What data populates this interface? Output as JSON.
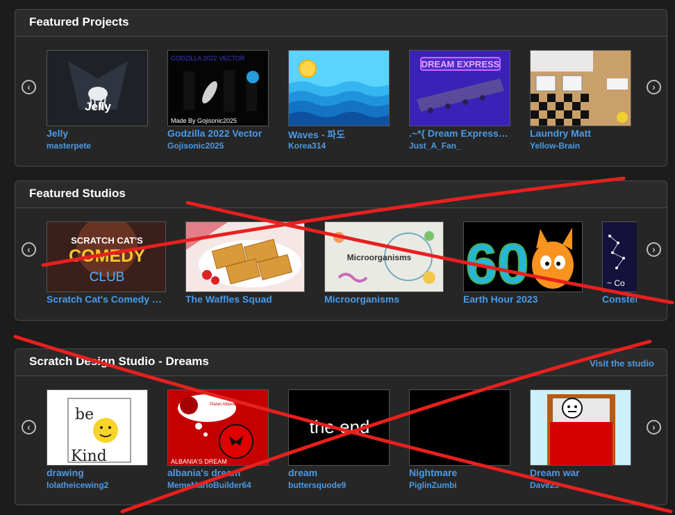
{
  "featured_projects": {
    "title": "Featured Projects",
    "items": [
      {
        "title": "Jelly",
        "author": "masterpete",
        "thumb_text": "Jelly"
      },
      {
        "title": "Godzilla 2022 Vector",
        "author": "Gojisonic2025",
        "thumb_text_top": "GODZILLA 2022 VECTOR",
        "thumb_text_bottom": "Made By Gojisonic2025"
      },
      {
        "title": "Waves - 파도",
        "author": "Korea314"
      },
      {
        "title": ".~*{ Dream Express }*~.",
        "author": "Just_A_Fan_",
        "thumb_text": "DREAM EXPRESS"
      },
      {
        "title": "Laundry Matt",
        "author": "Yellow-Brain"
      }
    ]
  },
  "featured_studios": {
    "title": "Featured Studios",
    "items": [
      {
        "title": "Scratch Cat's Comedy Club",
        "thumb_text_top": "SCRATCH CAT'S",
        "thumb_text_mid": "COMEDY",
        "thumb_text_bottom": "CLUB"
      },
      {
        "title": "The Waffles Squad"
      },
      {
        "title": "Microorganisms",
        "thumb_text": "Microorganisms"
      },
      {
        "title": "Earth Hour 2023",
        "thumb_text": "60"
      },
      {
        "title": "Constellations",
        "thumb_text": "~ Co"
      }
    ]
  },
  "design_studio": {
    "title": "Scratch Design Studio - Dreams",
    "link": "Visit the studio",
    "items": [
      {
        "title": "drawing",
        "author": "lolatheicewing2",
        "thumb_text_top": "be",
        "thumb_text_bottom": "Kind"
      },
      {
        "title": "albania's dream",
        "author": "MemeMarioBuilder64",
        "thumb_text_top": "Planet Albania",
        "thumb_text_bottom": "ALBANIA'S DREAM"
      },
      {
        "title": "dream",
        "author": "buttersquode9",
        "thumb_text": "the end"
      },
      {
        "title": "Nightmare",
        "author": "PiglinZumbi"
      },
      {
        "title": "Dream war",
        "author": "Dave23"
      }
    ]
  },
  "icons": {
    "prev": "‹",
    "next": "›"
  },
  "colors": {
    "link": "#4a9be8",
    "panel": "#262626",
    "background": "#1c1c1c",
    "overlay_marks": "#e8201e"
  }
}
